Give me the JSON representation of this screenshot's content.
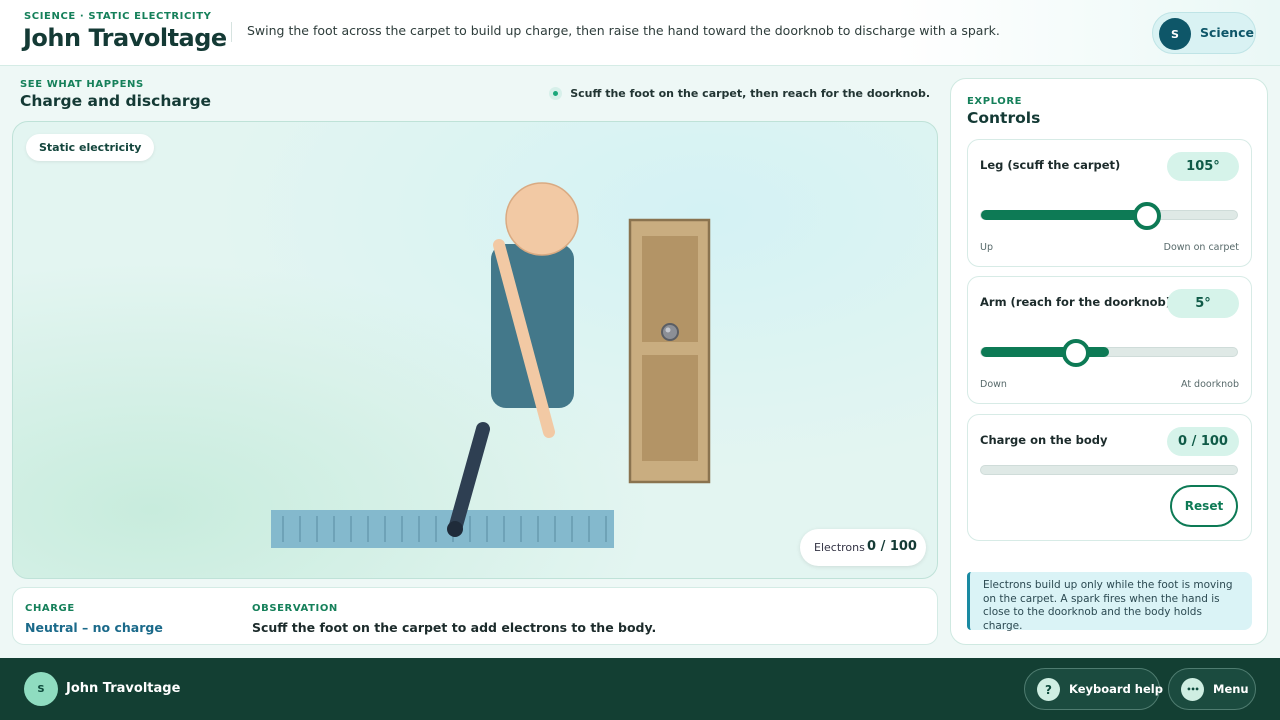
{
  "header": {
    "eyebrow": "SCIENCE · STATIC ELECTRICITY",
    "title": "John Travoltage",
    "description": "Swing the foot across the carpet to build up charge, then raise the hand toward the doorknob to discharge with a spark.",
    "subject_avatar": "S",
    "subject_label": "Science"
  },
  "stage_section": {
    "eyebrow": "SEE WHAT HAPPENS",
    "title": "Charge and discharge",
    "hint": "Scuff the foot on the carpet, then reach for the doorknob.",
    "badge": "Static electricity",
    "electrons_label": "Electrons",
    "electrons_value": "0 / 100"
  },
  "status": {
    "charge_label": "CHARGE",
    "charge_value": "Neutral – no charge",
    "observation_label": "OBSERVATION",
    "observation_value": "Scuff the foot on the carpet to add electrons to the body."
  },
  "controls": {
    "eyebrow": "EXPLORE",
    "title": "Controls",
    "leg": {
      "label": "Leg (scuff the carpet)",
      "value_text": "105°",
      "fraction": 0.65,
      "min_label": "Up",
      "max_label": "Down on carpet"
    },
    "arm": {
      "label": "Arm (reach for the doorknob)",
      "value_text": "5°",
      "fraction": 0.37,
      "fill_fraction": 0.5,
      "min_label": "Down",
      "max_label": "At doorknob"
    },
    "charge": {
      "label": "Charge on the body",
      "value_text": "0 / 100",
      "fraction": 0
    },
    "reset_label": "Reset",
    "note": "Electrons build up only while the foot is moving on the carpet. A spark fires when the hand is close to the doorknob and the body holds charge."
  },
  "footer": {
    "avatar": "S",
    "name": "John Travoltage",
    "help_icon": "?",
    "help_label": "Keyboard help",
    "menu_icon": "•••",
    "menu_label": "Menu"
  },
  "colors": {
    "accent": "#0d7a55",
    "skin": "#f2c9a4",
    "shirt": "#43788a",
    "leg": "#2e3f52",
    "carpet": "#84b9cd",
    "door": "#c9ad80",
    "footer": "#133f33"
  },
  "icons": {
    "hint": "status-dot-icon",
    "help": "question-mark-icon",
    "menu": "more-dots-icon"
  }
}
